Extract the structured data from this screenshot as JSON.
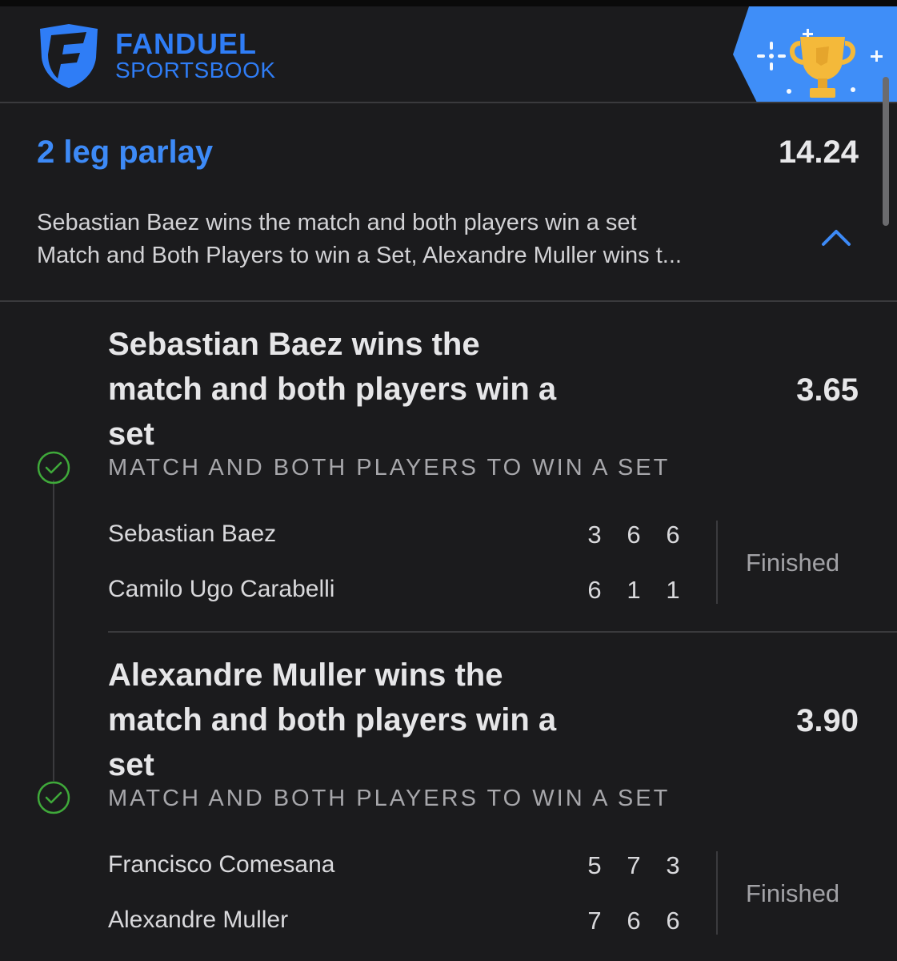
{
  "brand": {
    "name_top": "FANDUEL",
    "name_bottom": "SPORTSBOOK",
    "logo_icon": "fanduel-shield-logo",
    "promo_icon": "trophy-icon",
    "accent_color": "#2f7df6"
  },
  "parlay": {
    "title": "2 leg parlay",
    "odds": "14.24",
    "description_line1": "Sebastian Baez wins the match and both players win a set",
    "description_line2": "Match and Both Players to win a Set, Alexandre Muller wins t...",
    "toggle_icon": "chevron-up-icon"
  },
  "legs": [
    {
      "title_line1": "Sebastian Baez wins the",
      "title_line2": "match and both players win a",
      "title_line3": "set",
      "odds": "3.65",
      "market": "MATCH AND BOTH PLAYERS TO WIN A SET",
      "status_icon": "check-circle-icon",
      "status": "Finished",
      "players": [
        {
          "name": "Sebastian Baez",
          "scores": [
            "3",
            "6",
            "6"
          ]
        },
        {
          "name": "Camilo Ugo Carabelli",
          "scores": [
            "6",
            "1",
            "1"
          ]
        }
      ]
    },
    {
      "title_line1": "Alexandre Muller wins the",
      "title_line2": "match and both players win a",
      "title_line3": "set",
      "odds": "3.90",
      "market": "MATCH AND BOTH PLAYERS TO WIN A SET",
      "status_icon": "check-circle-icon",
      "status": "Finished",
      "players": [
        {
          "name": "Francisco Comesana",
          "scores": [
            "5",
            "7",
            "3"
          ]
        },
        {
          "name": "Alexandre Muller",
          "scores": [
            "7",
            "6",
            "6"
          ]
        }
      ]
    }
  ]
}
